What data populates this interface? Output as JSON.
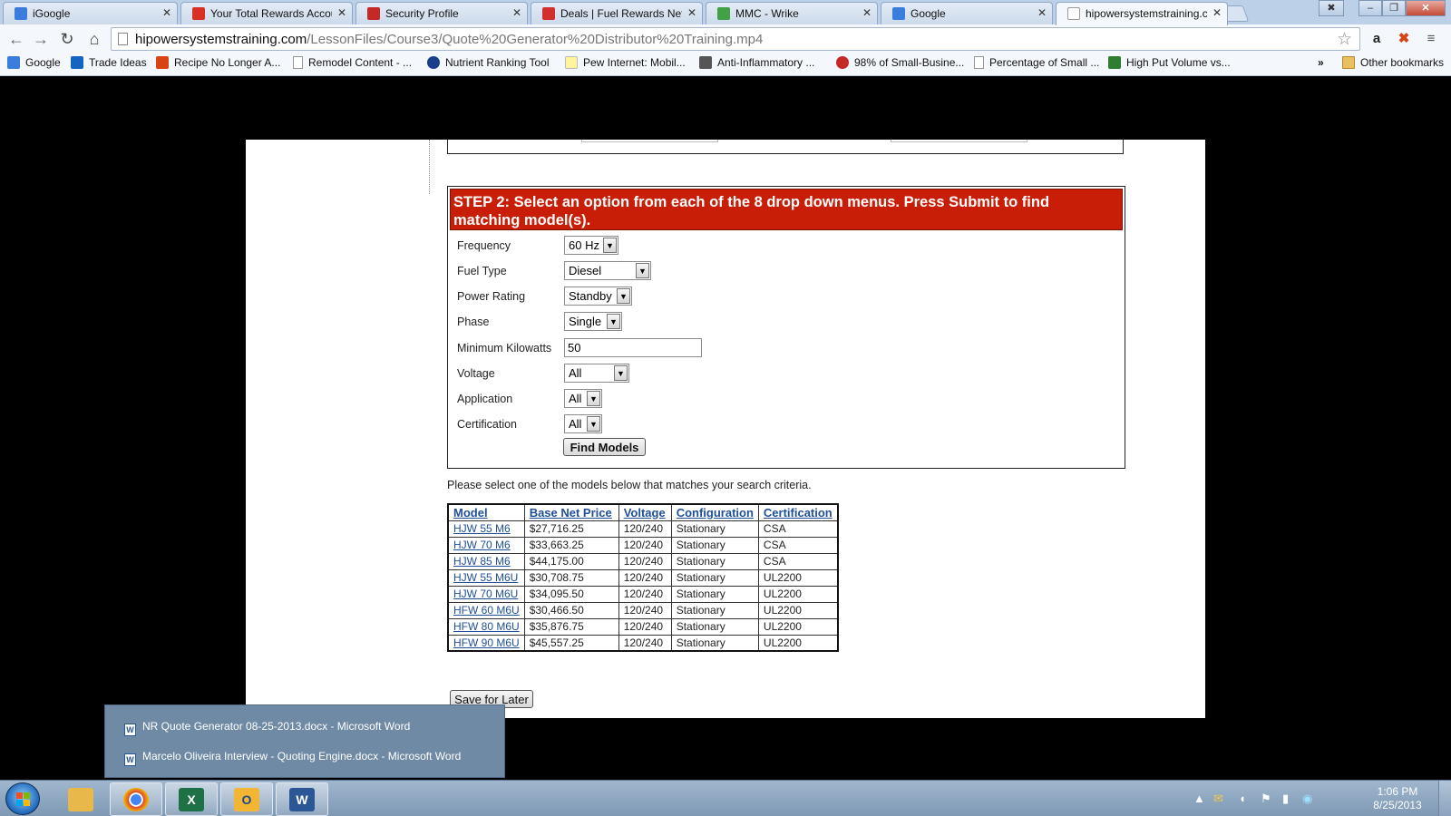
{
  "tabs": [
    {
      "title": "iGoogle",
      "favicon_color": "#3b7ddd"
    },
    {
      "title": "Your Total Rewards Accou",
      "favicon_color": "#d93025"
    },
    {
      "title": "Security Profile",
      "favicon_color": "#c62828"
    },
    {
      "title": "Deals | Fuel Rewards Netw",
      "favicon_color": "#d32f2f"
    },
    {
      "title": "MMC - Wrike",
      "favicon_color": "#43a047"
    },
    {
      "title": "Google",
      "favicon_color": "#3b7ddd"
    },
    {
      "title": "hipowersystemstraining.c",
      "favicon_color": "#cccccc"
    }
  ],
  "address": {
    "host": "hipowersystemstraining.com",
    "path": "/LessonFiles/Course3/Quote%20Generator%20Distributor%20Training.mp4"
  },
  "nav_icons": [
    "back-arrow-icon",
    "forward-arrow-icon",
    "reload-icon",
    "home-icon",
    "bookmark-star-icon"
  ],
  "bookmarks": [
    {
      "label": "Google",
      "color": "#3b7ddd"
    },
    {
      "label": "Trade Ideas",
      "color": "#1565c0"
    },
    {
      "label": "Recipe No Longer A...",
      "color": "#d84315"
    },
    {
      "label": "Remodel Content - ...",
      "color": "#ffffff"
    },
    {
      "label": "Nutrient Ranking Tool",
      "color": "#1a3e8c"
    },
    {
      "label": "Pew Internet: Mobil...",
      "color": "#fff59d"
    },
    {
      "label": "Anti-Inflammatory ...",
      "color": "#555555"
    },
    {
      "label": "98% of Small-Busine...",
      "color": "#c62828"
    },
    {
      "label": "Percentage of Small ...",
      "color": "#ffffff"
    },
    {
      "label": "High Put Volume vs...",
      "color": "#2e7d32"
    }
  ],
  "bookmarks_more": "»",
  "other_bookmarks": "Other bookmarks",
  "step2": {
    "heading": "STEP 2: Select an option from each of the 8 drop down menus. Press Submit to find matching model(s).",
    "fields": {
      "frequency": {
        "label": "Frequency",
        "value": "60 Hz"
      },
      "fuel_type": {
        "label": "Fuel Type",
        "value": "Diesel"
      },
      "power_rating": {
        "label": "Power Rating",
        "value": "Standby"
      },
      "phase": {
        "label": "Phase",
        "value": "Single"
      },
      "min_kw": {
        "label": "Minimum Kilowatts",
        "value": "50"
      },
      "voltage": {
        "label": "Voltage",
        "value": "All"
      },
      "application": {
        "label": "Application",
        "value": "All"
      },
      "certification": {
        "label": "Certification",
        "value": "All"
      }
    },
    "find_button": "Find Models",
    "accent_color": "#c81d07"
  },
  "results": {
    "instruction": "Please select one of the models below that matches your search criteria.",
    "columns": [
      "Model",
      "Base Net Price",
      "Voltage",
      "Configuration",
      "Certification"
    ],
    "rows": [
      [
        "HJW 55 M6",
        "$27,716.25",
        "120/240",
        "Stationary",
        "CSA"
      ],
      [
        "HJW 70 M6",
        "$33,663.25",
        "120/240",
        "Stationary",
        "CSA"
      ],
      [
        "HJW 85 M6",
        "$44,175.00",
        "120/240",
        "Stationary",
        "CSA"
      ],
      [
        "HJW 55 M6U",
        "$30,708.75",
        "120/240",
        "Stationary",
        "UL2200"
      ],
      [
        "HJW 70 M6U",
        "$34,095.50",
        "120/240",
        "Stationary",
        "UL2200"
      ],
      [
        "HFW 60 M6U",
        "$30,466.50",
        "120/240",
        "Stationary",
        "UL2200"
      ],
      [
        "HFW 80 M6U",
        "$35,876.75",
        "120/240",
        "Stationary",
        "UL2200"
      ],
      [
        "HFW 90 M6U",
        "$45,557.25",
        "120/240",
        "Stationary",
        "UL2200"
      ]
    ]
  },
  "save_button": "Save for Later",
  "jumplist": [
    "NR Quote Generator 08-25-2013.docx - Microsoft Word",
    "Marcelo Oliveira Interview - Quoting Engine.docx - Microsoft Word"
  ],
  "taskbar": {
    "apps": [
      {
        "name": "windows-explorer",
        "icon": "folder-icon",
        "color": "#e8b84a"
      },
      {
        "name": "chrome",
        "icon": "chrome-icon",
        "color": "#4caf50"
      },
      {
        "name": "excel",
        "icon": "excel-icon",
        "color": "#1e7145"
      },
      {
        "name": "outlook",
        "icon": "outlook-icon",
        "color": "#f2b632"
      },
      {
        "name": "word",
        "icon": "word-icon",
        "color": "#2b5797"
      }
    ],
    "time": "1:06 PM",
    "date": "8/25/2013"
  }
}
